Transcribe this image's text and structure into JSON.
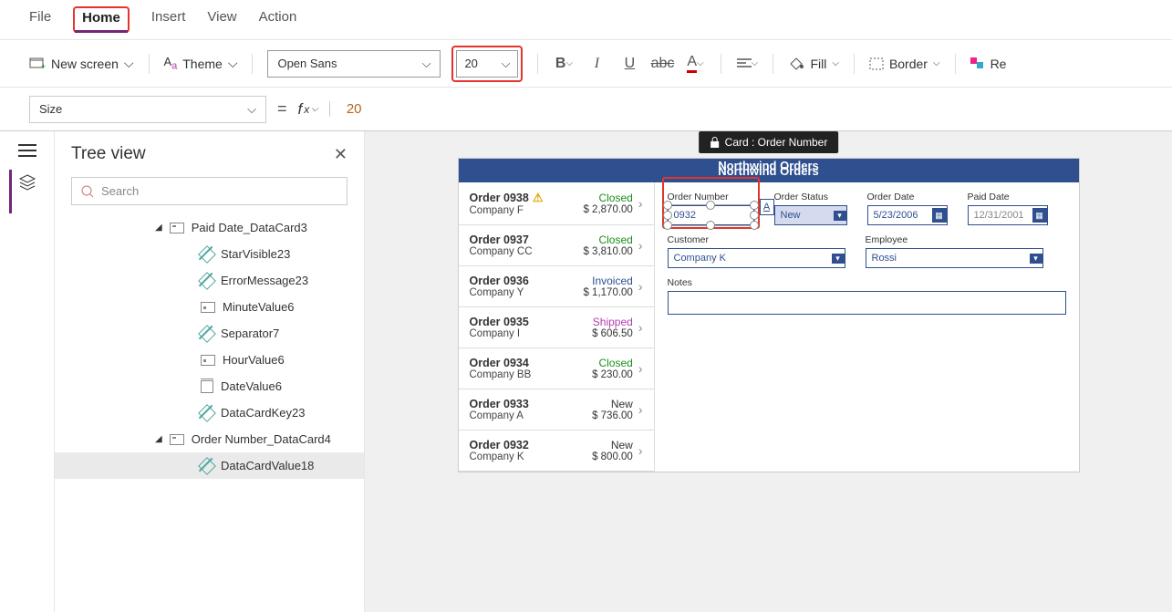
{
  "menu": {
    "file": "File",
    "home": "Home",
    "insert": "Insert",
    "view": "View",
    "action": "Action"
  },
  "toolbar": {
    "new_screen": "New screen",
    "theme": "Theme",
    "font": "Open Sans",
    "font_size": "20",
    "fill": "Fill",
    "border": "Border",
    "reorder": "Re"
  },
  "formula": {
    "prop": "Size",
    "value": "20"
  },
  "tree": {
    "title": "Tree view",
    "search_placeholder": "Search",
    "items": [
      {
        "type": "node",
        "label": "Paid Date_DataCard3"
      },
      {
        "type": "leaf",
        "icon": "edit",
        "label": "StarVisible23"
      },
      {
        "type": "leaf",
        "icon": "edit",
        "label": "ErrorMessage23"
      },
      {
        "type": "leaf",
        "icon": "fld",
        "label": "MinuteValue6"
      },
      {
        "type": "leaf",
        "icon": "edit",
        "label": "Separator7"
      },
      {
        "type": "leaf",
        "icon": "fld",
        "label": "HourValue6"
      },
      {
        "type": "leaf",
        "icon": "cal",
        "label": "DateValue6"
      },
      {
        "type": "leaf",
        "icon": "edit",
        "label": "DataCardKey23"
      },
      {
        "type": "node",
        "label": "Order Number_DataCard4"
      },
      {
        "type": "leaf",
        "icon": "edit",
        "label": "DataCardValue18",
        "selected": true
      }
    ]
  },
  "canvas": {
    "tooltip": "Card : Order Number",
    "app_title": "Northwind Orders",
    "orders": [
      {
        "id": "Order 0938",
        "company": "Company F",
        "status": "Closed",
        "amount": "$ 2,870.00",
        "warn": true
      },
      {
        "id": "Order 0937",
        "company": "Company CC",
        "status": "Closed",
        "amount": "$ 3,810.00"
      },
      {
        "id": "Order 0936",
        "company": "Company Y",
        "status": "Invoiced",
        "amount": "$ 1,170.00"
      },
      {
        "id": "Order 0935",
        "company": "Company I",
        "status": "Shipped",
        "amount": "$ 606.50"
      },
      {
        "id": "Order 0934",
        "company": "Company BB",
        "status": "Closed",
        "amount": "$ 230.00"
      },
      {
        "id": "Order 0933",
        "company": "Company A",
        "status": "New",
        "amount": "$ 736.00"
      },
      {
        "id": "Order 0932",
        "company": "Company K",
        "status": "New",
        "amount": "$ 800.00"
      }
    ],
    "form": {
      "order_number_label": "Order Number",
      "order_number_value": "0932",
      "order_status_label": "Order Status",
      "order_status_value": "New",
      "order_date_label": "Order Date",
      "order_date_value": "5/23/2006",
      "paid_date_label": "Paid Date",
      "paid_date_value": "12/31/2001",
      "customer_label": "Customer",
      "customer_value": "Company K",
      "employee_label": "Employee",
      "employee_value": "Rossi",
      "notes_label": "Notes"
    }
  }
}
